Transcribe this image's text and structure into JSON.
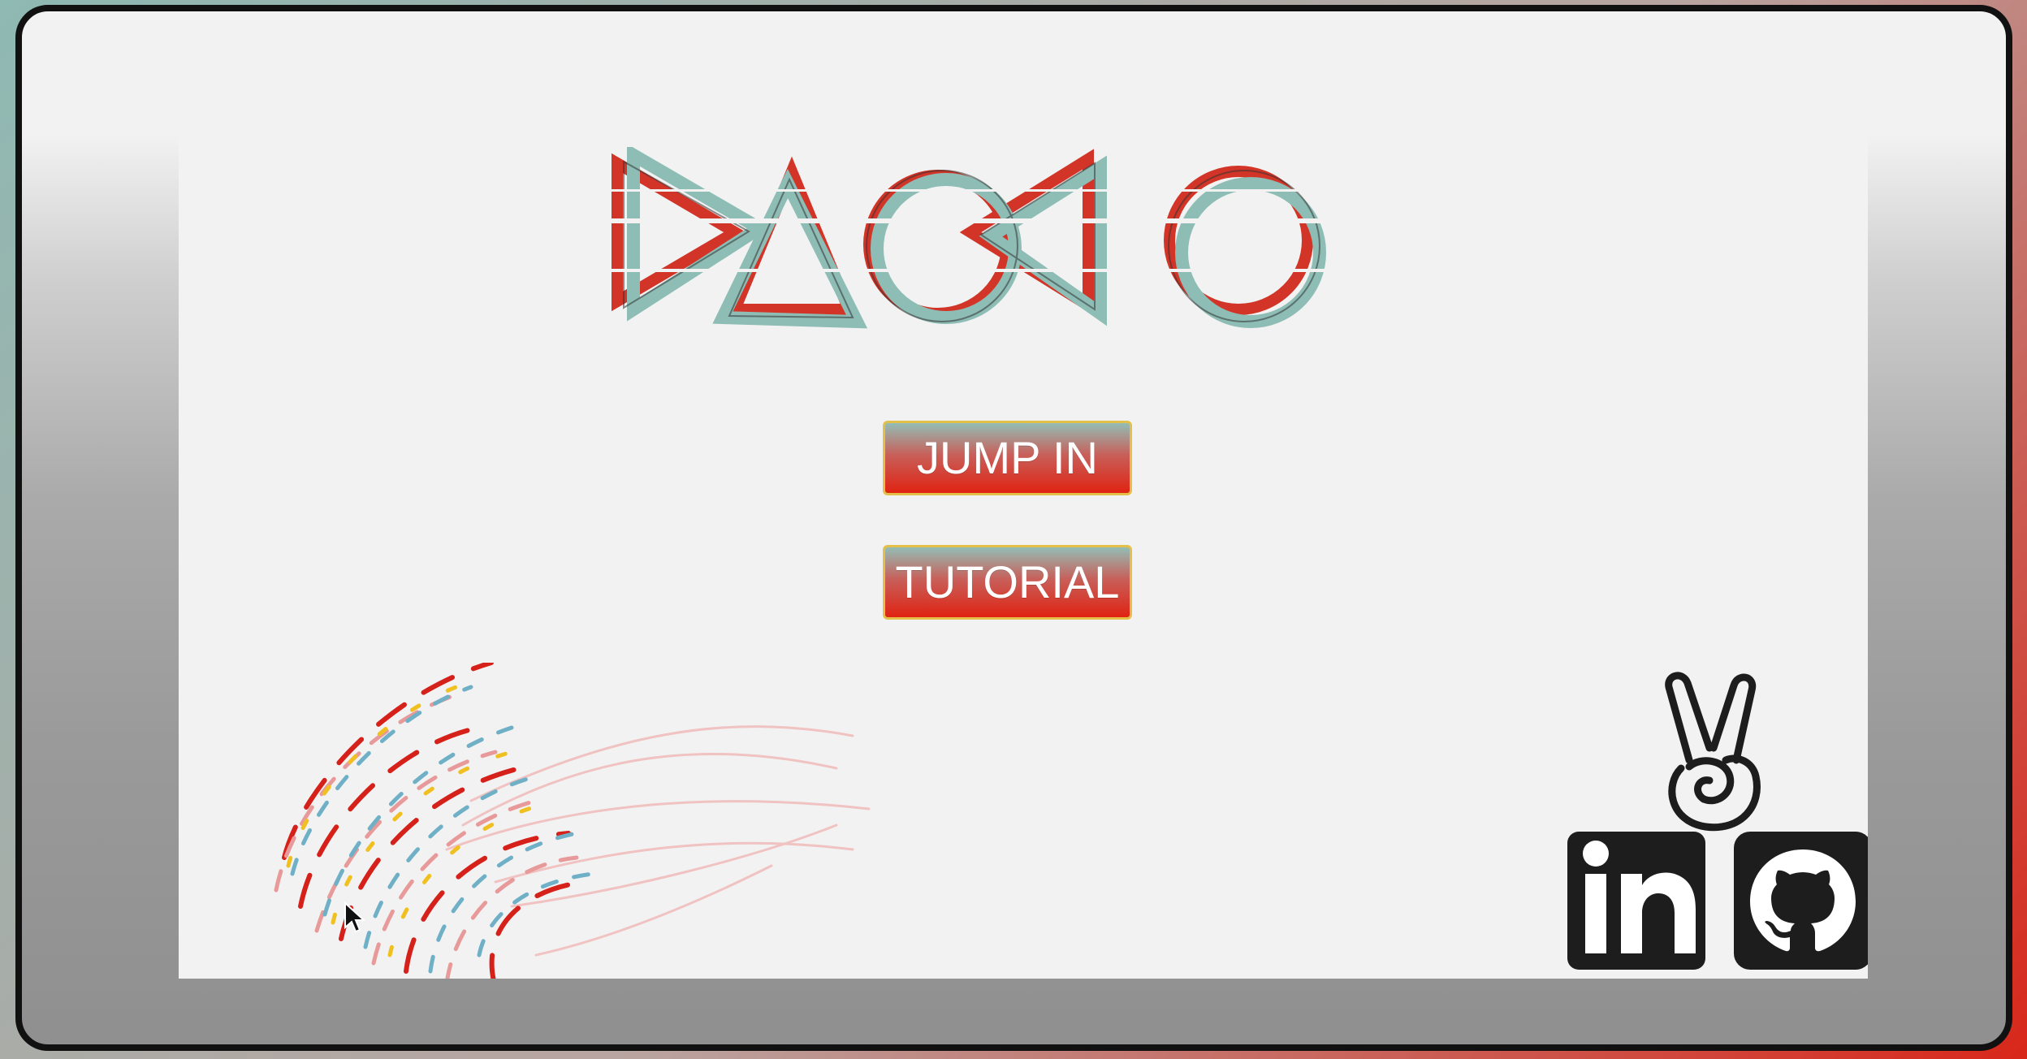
{
  "game": {
    "title": "PAOPAO",
    "menu": {
      "jump_in_label": "JUMP IN",
      "tutorial_label": "TUTORIAL"
    }
  },
  "social": {
    "links": [
      {
        "name": "LinkedIn",
        "icon": "linkedin-icon",
        "glyph": "in"
      },
      {
        "name": "GitHub",
        "icon": "github-icon"
      }
    ],
    "mascot_icon": "peace-hand-icon"
  },
  "colors": {
    "teal": "#8fbdb5",
    "red": "#d8271a",
    "yellow": "#f0c020",
    "button_border": "#e4c04a",
    "frame": "#111111",
    "canvas": "#f2f2f2"
  }
}
